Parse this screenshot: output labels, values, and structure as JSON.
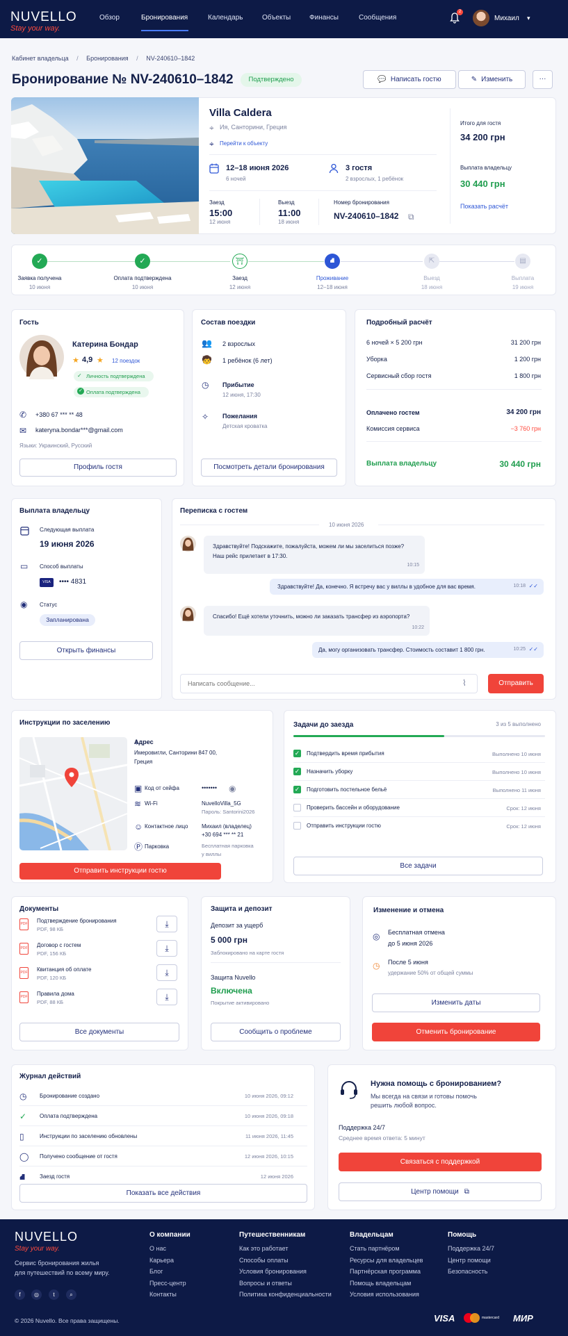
{
  "header": {
    "logo": "NUVELLO",
    "tagline": "Stay your way.",
    "nav": [
      "Обзор",
      "Бронирования",
      "Календарь",
      "Объекты",
      "Финансы",
      "Сообщения"
    ],
    "notif_count": "2",
    "user": "Михаил"
  },
  "breadcrumb": [
    "Кабинет владельца",
    "Бронирования",
    "NV-240610–1842"
  ],
  "page": {
    "title": "Бронирование № NV-240610–1842",
    "status": "Подтверждено",
    "btn_message": "Написать гостю",
    "btn_edit": "Изменить",
    "btn_more": "···"
  },
  "property": {
    "name": "Villa Caldera",
    "location": "Ия, Санторини, Греция",
    "link": "Перейти к объекту",
    "dates": "12–18 июня 2026",
    "nights": "6 ночей",
    "guests": "3 гостя",
    "guests_detail": "2 взрослых, 1 ребёнок",
    "checkin_label": "Заезд",
    "checkin_time": "15:00",
    "checkin_date": "12 июня",
    "checkout_label": "Выезд",
    "checkout_time": "11:00",
    "checkout_date": "18 июня",
    "booking_no_label": "Номер бронирования",
    "booking_no": "NV-240610–1842",
    "total_label": "Итого для гостя",
    "total": "34 200 грн",
    "payout_label": "Выплата владельцу",
    "payout": "30 440 грн",
    "calc_link": "Показать расчёт"
  },
  "steps": [
    {
      "label": "Заявка получена",
      "date": "10 июня"
    },
    {
      "label": "Оплата подтверждена",
      "date": "10 июня"
    },
    {
      "label": "Заезд",
      "date": "12 июня"
    },
    {
      "label": "Проживание",
      "date": "12–18 июня"
    },
    {
      "label": "Выезд",
      "date": "18 июня"
    },
    {
      "label": "Выплата",
      "date": "19 июня"
    }
  ],
  "guest": {
    "title": "Гость",
    "name": "Катерина Бондар",
    "rating": "4,9",
    "trips": "12 поездок",
    "verified_id": "Личность подтверждена",
    "verified_pay": "Оплата подтверждена",
    "phone": "+380 67 *** ** 48",
    "email": "kateryna.bondar***@gmail.com",
    "languages": "Языки: Украинский, Русский",
    "btn": "Профиль гостя"
  },
  "trip": {
    "title": "Состав поездки",
    "adults": "2 взрослых",
    "child": "1 ребёнок (6 лет)",
    "arrival_label": "Прибытие",
    "arrival": "12 июня, 17:30",
    "wishes_label": "Пожелания",
    "wishes": "Детская кроватка",
    "btn": "Посмотреть детали бронирования"
  },
  "calc": {
    "title": "Подробный расчёт",
    "rows": [
      {
        "l": "6 ночей × 5 200 грн",
        "v": "31 200 грн"
      },
      {
        "l": "Уборка",
        "v": "1 200 грн"
      },
      {
        "l": "Сервисный сбор гостя",
        "v": "1 800 грн"
      }
    ],
    "paid_label": "Оплачено гостем",
    "paid": "34 200 грн",
    "fee_label": "Комиссия сервиса",
    "fee": "−3 760 грн",
    "payout_label": "Выплата владельцу",
    "payout": "30 440 грн"
  },
  "payout": {
    "title": "Выплата владельцу",
    "next_label": "Следующая выплата",
    "next": "19 июня 2026",
    "method_label": "Способ выплаты",
    "card_brand": "VISA",
    "card": "•••• 4831",
    "status_label": "Статус",
    "status": "Запланирована",
    "btn": "Открыть финансы"
  },
  "chat": {
    "title": "Переписка с гостем",
    "date": "10 июня 2026",
    "messages": [
      {
        "text1": "Здравствуйте! Подскажите, пожалуйста, можем ли мы заселиться позже?",
        "text2": "Наш рейс прилетает в 17:30.",
        "time": "10:15"
      },
      {
        "text1": "Здравствуйте! Да, конечно. Я встречу вас у виллы в удобное для вас время.",
        "time": "10:18"
      },
      {
        "text1": "Спасибо! Ещё хотели уточнить, можно ли заказать трансфер из аэропорта?",
        "time": "10:22"
      },
      {
        "text1": "Да, могу организовать трансфер. Стоимость составит 1 800 грн.",
        "time": "10:25"
      }
    ],
    "placeholder": "Написать сообщение...",
    "send": "Отправить"
  },
  "instructions": {
    "title": "Инструкции по заселению",
    "addr_label": "Адрес",
    "addr": "Имеровигли, Санторини 847 00,",
    "addr2": "Греция",
    "safe_label": "Код от сейфа",
    "safe": "•••••••",
    "wifi_label": "Wi-Fi",
    "wifi": "NuvelloVilla_5G",
    "wifi_pass": "Пароль: Santorini2026",
    "contact_label": "Контактное лицо",
    "contact": "Михаил (владелец)",
    "contact_phone": "+30 694 *** ** 21",
    "parking_label": "Парковка",
    "parking": "Бесплатная парковка",
    "parking2": "у виллы",
    "btn": "Отправить инструкции гостю"
  },
  "tasks": {
    "title": "Задачи до заезда",
    "progress_text": "3 из 5 выполнено",
    "progress": 0.6,
    "items": [
      {
        "l": "Подтвердить время прибытия",
        "s": "Выполнено 10 июня",
        "done": true
      },
      {
        "l": "Назначить уборку",
        "s": "Выполнено 10 июня",
        "done": true
      },
      {
        "l": "Подготовить постельное бельё",
        "s": "Выполнено 11 июня",
        "done": true
      },
      {
        "l": "Проверить бассейн и оборудование",
        "s": "Срок: 12 июня",
        "done": false
      },
      {
        "l": "Отправить инструкции гостю",
        "s": "Срок: 12 июня",
        "done": false
      }
    ],
    "btn": "Все задачи"
  },
  "docs": {
    "title": "Документы",
    "items": [
      {
        "n": "Подтверждение бронирования",
        "m": "PDF, 98 КБ"
      },
      {
        "n": "Договор с гостем",
        "m": "PDF, 156 КБ"
      },
      {
        "n": "Квитанция об оплате",
        "m": "PDF, 120 КБ"
      },
      {
        "n": "Правила дома",
        "m": "PDF, 88 КБ"
      }
    ],
    "btn": "Все документы"
  },
  "deposit": {
    "title": "Защита и депозит",
    "dep_label": "Депозит за ущерб",
    "dep": "5 000 грн",
    "dep_note": "Заблокировано на карте гостя",
    "prot_label": "Защита Nuvello",
    "prot": "Включена",
    "prot_note": "Покрытие активировано",
    "btn": "Сообщить о проблеме"
  },
  "cancel": {
    "title": "Изменение и отмена",
    "free_label": "Бесплатная отмена",
    "free": "до 5 июня 2026",
    "after_label": "После 5 июня",
    "after": "удержание 50% от общей суммы",
    "btn_change": "Изменить даты",
    "btn_cancel": "Отменить бронирование"
  },
  "log": {
    "title": "Журнал действий",
    "items": [
      {
        "l": "Бронирование создано",
        "d": "10 июня 2026, 09:12"
      },
      {
        "l": "Оплата подтверждена",
        "d": "10 июня 2026, 09:18"
      },
      {
        "l": "Инструкции по заселению обновлены",
        "d": "11 июня 2026, 11:45"
      },
      {
        "l": "Получено сообщение от гостя",
        "d": "12 июня 2026, 10:15"
      },
      {
        "l": "Заезд гостя",
        "d": "12 июня 2026"
      }
    ],
    "btn": "Показать все действия"
  },
  "help": {
    "title": "Нужна помощь с бронированием?",
    "text1": "Мы всегда на связи и готовы помочь",
    "text2": "решить любой вопрос.",
    "support": "Поддержка 24/7",
    "resp": "Среднее время ответа: 5 минут",
    "btn": "Связаться с поддержкой",
    "btn2": "Центр помощи"
  },
  "footer": {
    "logo": "NUVELLO",
    "tagline": "Stay your way.",
    "desc1": "Сервис бронирования жилья",
    "desc2": "для путешествий по всему миру.",
    "copyright": "© 2026 Nuvello. Все права защищены.",
    "cols": [
      {
        "h": "О компании",
        "items": [
          "О нас",
          "Карьера",
          "Блог",
          "Пресс-центр",
          "Контакты"
        ]
      },
      {
        "h": "Путешественникам",
        "items": [
          "Как это работает",
          "Способы оплаты",
          "Условия бронирования",
          "Вопросы и ответы",
          "Политика конфиденциальности"
        ]
      },
      {
        "h": "Владельцам",
        "items": [
          "Стать партнёром",
          "Ресурсы для владельцев",
          "Партнёрская программа",
          "Помощь владельцам",
          "Условия использования"
        ]
      },
      {
        "h": "Помощь",
        "items": [
          "Поддержка 24/7",
          "Центр помощи",
          "Безопасность"
        ]
      }
    ],
    "pay": [
      "VISA",
      "mastercard",
      "МИР"
    ]
  }
}
